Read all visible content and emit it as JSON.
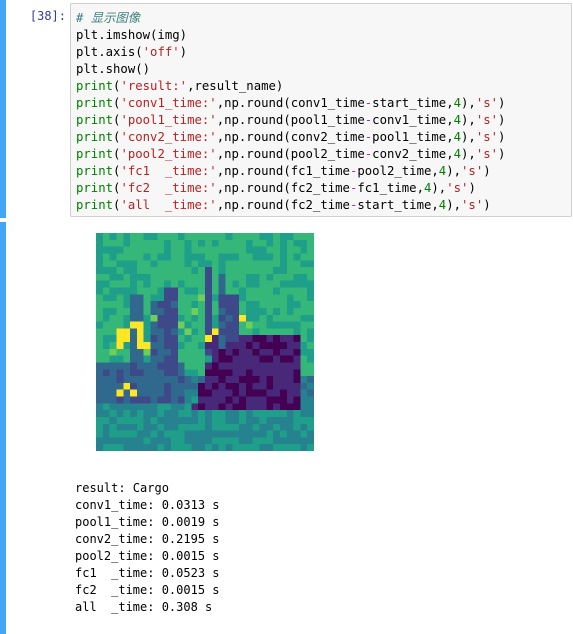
{
  "input_cell": {
    "prompt": "[38]:",
    "code": [
      {
        "t": "com",
        "v": "# 显示图像"
      },
      {
        "t": "code",
        "v": "plt.imshow(img)"
      },
      {
        "t": "code",
        "v": "plt.axis('off')"
      },
      {
        "t": "code",
        "v": "plt.show()"
      },
      {
        "t": "code",
        "v": "print('result:',result_name)"
      },
      {
        "t": "code",
        "v": "print('conv1_time:',np.round(conv1_time-start_time,4),'s')"
      },
      {
        "t": "code",
        "v": "print('pool1_time:',np.round(pool1_time-conv1_time,4),'s')"
      },
      {
        "t": "code",
        "v": "print('conv2_time:',np.round(conv2_time-pool1_time,4),'s')"
      },
      {
        "t": "code",
        "v": "print('pool2_time:',np.round(pool2_time-conv2_time,4),'s')"
      },
      {
        "t": "code",
        "v": "print('fc1  _time:',np.round(fc1_time-pool2_time,4),'s')"
      },
      {
        "t": "code",
        "v": "print('fc2  _time:',np.round(fc2_time-fc1_time,4),'s')"
      },
      {
        "t": "code",
        "v": "print('all  _time:',np.round(fc2_time-start_time,4),'s')"
      }
    ]
  },
  "output_cell": {
    "image_description": "32x32 viridis pixel image of a cargo ship",
    "lines": [
      "result: Cargo",
      "conv1_time: 0.0313 s",
      "pool1_time: 0.0019 s",
      "conv2_time: 0.2195 s",
      "pool2_time: 0.0015 s",
      "fc1  _time: 0.0523 s",
      "fc2  _time: 0.0015 s",
      "all  _time: 0.308 s"
    ]
  },
  "colors": {
    "cell_bar": "#42a5f5",
    "prompt": "#303f9f",
    "keyword": "#008000",
    "string": "#ba2121"
  }
}
